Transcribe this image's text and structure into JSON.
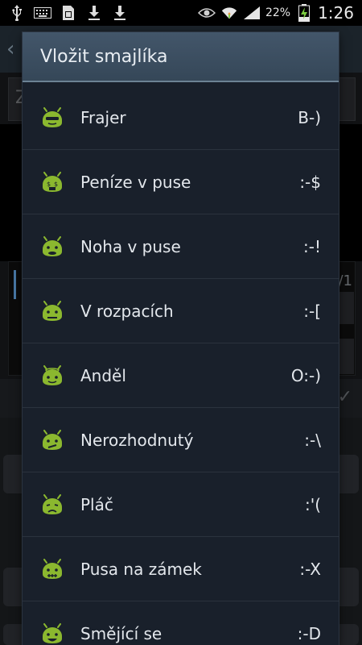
{
  "status_bar": {
    "battery": "22%",
    "time": "1:26",
    "icons_left": [
      "usb-icon",
      "keyboard-icon",
      "sim-icon",
      "download-icon",
      "download-icon"
    ],
    "icons_right": [
      "eye-icon",
      "wifi-icon",
      "signal-icon",
      "battery-icon"
    ]
  },
  "background_app": {
    "field_text": "Z",
    "counter": "/1"
  },
  "dialog": {
    "title": "Vložit smajlíka",
    "items": [
      {
        "label": "Frajer",
        "code": "B-)",
        "icon": "android-cool-icon"
      },
      {
        "label": "Peníze v puse",
        "code": ":-$",
        "icon": "android-money-icon"
      },
      {
        "label": "Noha v puse",
        "code": ":-!",
        "icon": "android-foot-icon"
      },
      {
        "label": "V rozpacích",
        "code": ":-[",
        "icon": "android-embarrassed-icon"
      },
      {
        "label": "Anděl",
        "code": "O:-)",
        "icon": "android-angel-icon"
      },
      {
        "label": "Nerozhodnutý",
        "code": ":-\\",
        "icon": "android-undecided-icon"
      },
      {
        "label": "Pláč",
        "code": ":'(",
        "icon": "android-cry-icon"
      },
      {
        "label": "Pusa na zámek",
        "code": ":-X",
        "icon": "android-lips-sealed-icon"
      },
      {
        "label": "Smějící se",
        "code": ":-D",
        "icon": "android-laughing-icon"
      }
    ]
  },
  "colors": {
    "dialog_bg": "#19202b",
    "header_bg": "#3d4f61",
    "android_green": "#8bb82f",
    "text": "#e3e7ec"
  }
}
